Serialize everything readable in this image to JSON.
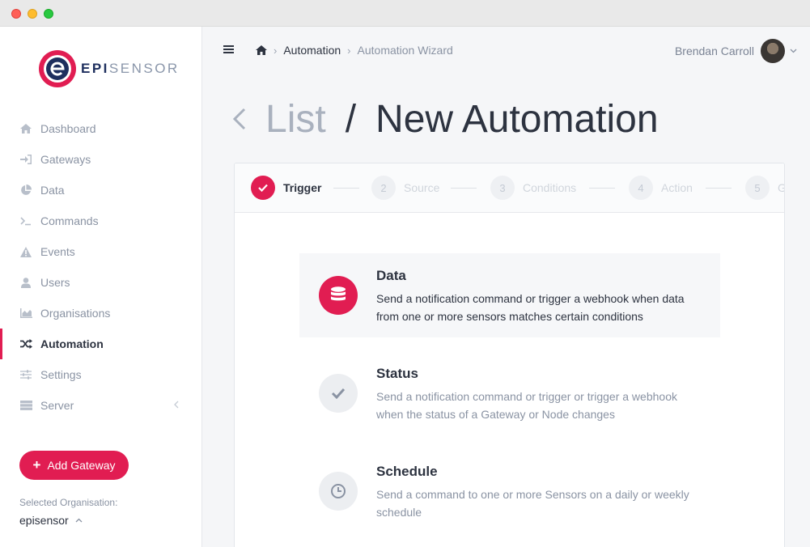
{
  "brand": {
    "name_part1": "EPI",
    "name_part2": "SENSOR",
    "accent_color": "#e11d52",
    "navy_color": "#1e2f5e"
  },
  "sidebar": {
    "items": [
      {
        "label": "Dashboard",
        "icon": "home-icon",
        "active": false
      },
      {
        "label": "Gateways",
        "icon": "sign-in-icon",
        "active": false
      },
      {
        "label": "Data",
        "icon": "pie-chart-icon",
        "active": false
      },
      {
        "label": "Commands",
        "icon": "terminal-icon",
        "active": false
      },
      {
        "label": "Events",
        "icon": "warning-icon",
        "active": false
      },
      {
        "label": "Users",
        "icon": "user-icon",
        "active": false
      },
      {
        "label": "Organisations",
        "icon": "area-chart-icon",
        "active": false
      },
      {
        "label": "Automation",
        "icon": "random-icon",
        "active": true
      },
      {
        "label": "Settings",
        "icon": "sliders-icon",
        "active": false
      },
      {
        "label": "Server",
        "icon": "server-icon",
        "active": false
      }
    ],
    "add_gateway_label": "Add Gateway",
    "selected_org_label": "Selected Organisation:",
    "selected_org_value": "episensor"
  },
  "header": {
    "breadcrumb": [
      "Automation",
      "Automation Wizard"
    ],
    "user_name": "Brendan Carroll"
  },
  "page": {
    "back_label": "List",
    "separator": "/",
    "title": "New Automation"
  },
  "wizard": {
    "steps": [
      {
        "number": "1",
        "label": "Trigger",
        "state": "done"
      },
      {
        "number": "2",
        "label": "Source",
        "state": "pending"
      },
      {
        "number": "3",
        "label": "Conditions",
        "state": "pending"
      },
      {
        "number": "4",
        "label": "Action",
        "state": "pending"
      },
      {
        "number": "5",
        "label": "General",
        "state": "pending"
      }
    ],
    "options": [
      {
        "title": "Data",
        "description": "Send a notification command or trigger a webhook when data from one or more sensors matches certain conditions",
        "icon": "database-icon",
        "selected": true
      },
      {
        "title": "Status",
        "description": "Send a notification command or trigger or trigger a webhook when the status of a Gateway or Node changes",
        "icon": "check-icon",
        "selected": false
      },
      {
        "title": "Schedule",
        "description": "Send a command to one or more Sensors on a daily or weekly schedule",
        "icon": "clock-icon",
        "selected": false
      }
    ]
  }
}
